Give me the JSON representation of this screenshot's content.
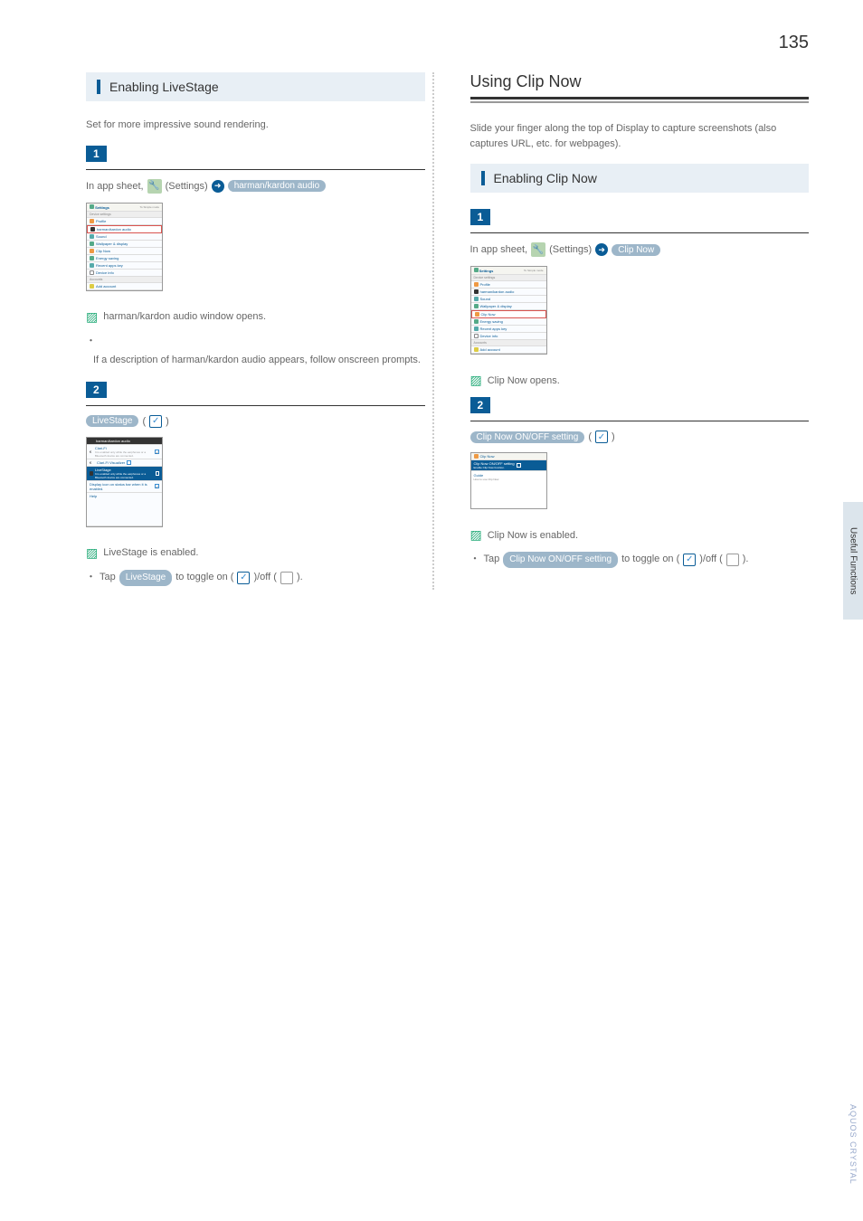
{
  "page_number": "135",
  "sidebar_tab": "Useful Functions",
  "footer_brand": "AQUOS CRYSTAL",
  "left": {
    "heading": "Enabling LiveStage",
    "intro": "Set for more impressive sound rendering.",
    "step1_num": "1",
    "step1_prefix": "In app sheet,",
    "step1_settings": "(Settings)",
    "step1_badge": "harman/kardon audio",
    "result1": "harman/kardon audio window opens.",
    "note1": "If a description of harman/kardon audio appears, follow onscreen prompts.",
    "step2_num": "2",
    "step2_badge": "LiveStage",
    "step2_paren_open": "(",
    "step2_paren_close": ")",
    "result2": "LiveStage is enabled.",
    "note2_a": "Tap",
    "note2_btn": "LiveStage",
    "note2_b": " to toggle on (",
    "note2_c": ")/off (",
    "note2_d": ").",
    "ps1": {
      "header": "Settings",
      "header_btn": "To Simple mode",
      "section1": "Device settings",
      "r1": "Profile",
      "r2": "harman/kardon audio",
      "r3": "Sound",
      "r4": "Wallpaper & display",
      "r5": "Clip Now",
      "r6": "Energy saving",
      "r7": "Recent apps key",
      "r8": "Device info",
      "section2": "Accounts",
      "r9": "Add account"
    },
    "ps2": {
      "t": "harman/kardon audio",
      "r1": "Clari-Fi",
      "r1s": "It is enabled only while the earphones or a Bluetooth device are connected.",
      "r2": "Clari-Fi Visualizer",
      "r3": "LiveStage",
      "r3s": "It is enabled only while the earphones or a Bluetooth device are connected.",
      "r4": "Display icon on status bar when it is enabled.",
      "r5": "Help"
    }
  },
  "right": {
    "main_heading": "Using Clip Now",
    "intro": "Slide your finger along the top of Display to capture screenshots (also captures URL, etc. for webpages).",
    "sub_heading": "Enabling Clip Now",
    "step1_num": "1",
    "step1_prefix": "In app sheet,",
    "step1_settings": "(Settings)",
    "step1_badge": "Clip Now",
    "result1": "Clip Now opens.",
    "step2_num": "2",
    "step2_badge": "Clip Now ON/OFF setting",
    "step2_paren_open": "(",
    "step2_paren_close": ")",
    "result2": "Clip Now is enabled.",
    "note2_a": "Tap",
    "note2_btn": "Clip Now ON/OFF setting",
    "note2_b": " to toggle on (",
    "note2_c": ")/off (",
    "note2_d": ").",
    "ps1": {
      "header": "Settings",
      "header_btn": "To Simple mode",
      "section1": "Device settings",
      "r1": "Profile",
      "r2": "harman/kardon audio",
      "r3": "Sound",
      "r4": "Wallpaper & display",
      "r5": "Clip Now",
      "r6": "Energy saving",
      "r7": "Recent apps key",
      "r8": "Device info",
      "section2": "Accounts",
      "r9": "Add account"
    },
    "ps2": {
      "t": "Clip Now",
      "r1": "Clip Now ON/OFF setting",
      "r1s": "Enable Clip Now function.",
      "r2": "Guide",
      "r2s": "How to use Clip Now."
    }
  }
}
